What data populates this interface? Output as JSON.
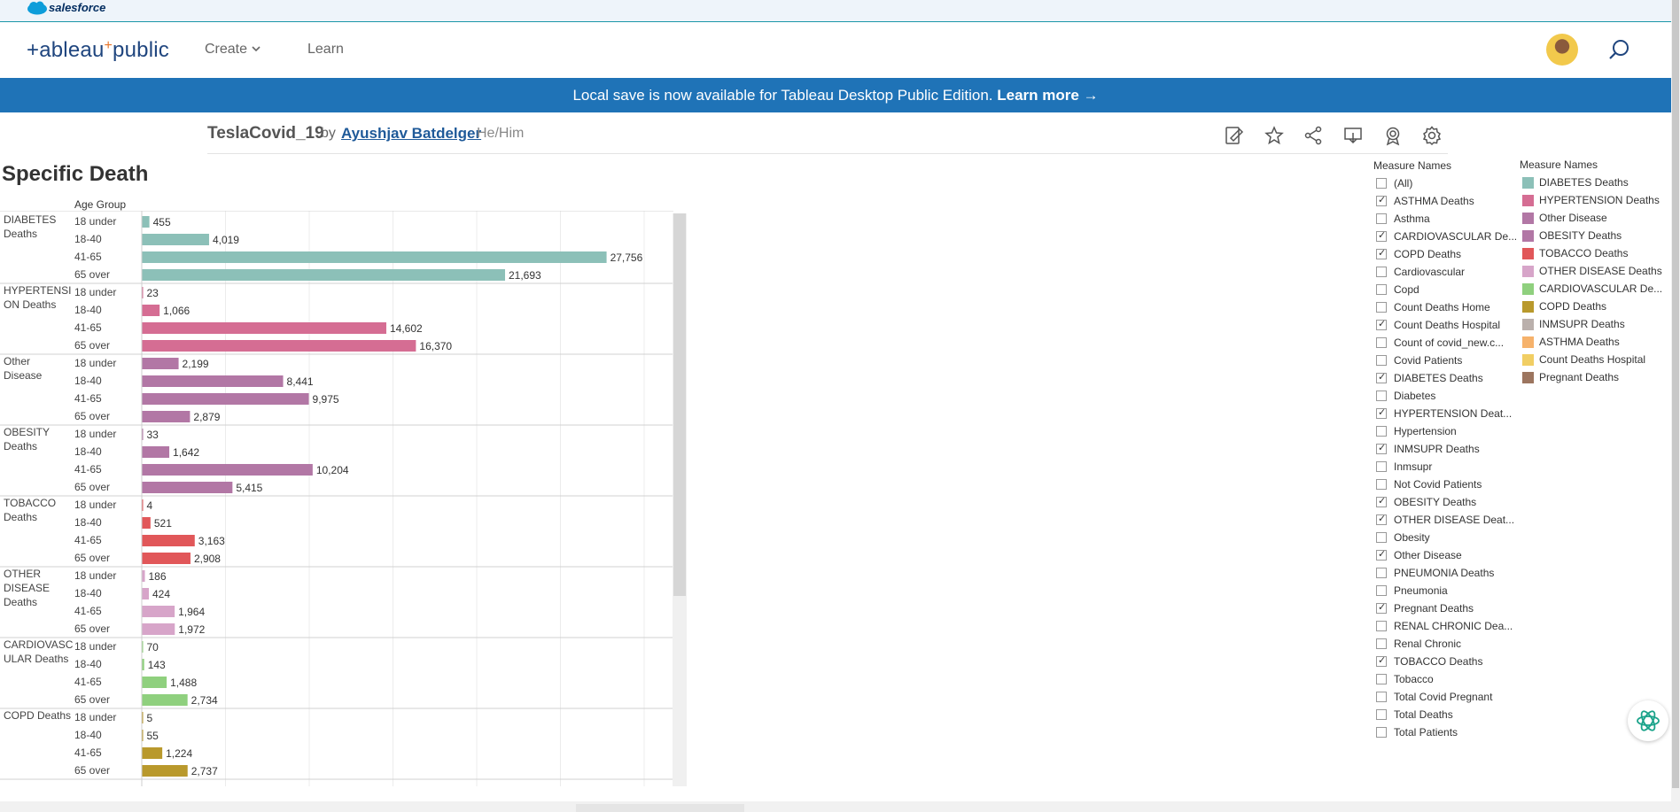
{
  "topbar": {
    "brand": "salesforce"
  },
  "header": {
    "logo_text": "+ableau",
    "logo_plus": "+",
    "logo_suffix": "public",
    "nav": [
      {
        "label": "Create"
      },
      {
        "label": "Learn"
      }
    ],
    "icons": [
      "chevron-down-icon",
      "avatar",
      "search-icon"
    ]
  },
  "banner": {
    "text": "Local save is now available for Tableau Desktop Public Edition.",
    "link": "Learn more →"
  },
  "viz": {
    "title": "TeslaCovid_19",
    "by": "by",
    "author": "Ayushjav Batdelger",
    "pronoun": "He/Him",
    "toolbar_icons": [
      "edit-icon",
      "star-icon",
      "share-icon",
      "download-icon",
      "badge-icon",
      "settings-icon"
    ]
  },
  "sheet": {
    "title": "Specific Death",
    "age_header": "Age Group"
  },
  "colors": {
    "DIABETES Deaths": "#8cc0b8",
    "HYPERTENSION Deaths": "#d56d93",
    "Other Disease": "#b277a5",
    "OBESITY Deaths": "#b277a5",
    "TOBACCO Deaths": "#e15759",
    "OTHER DISEASE Deaths": "#d7a5c9",
    "CARDIOVASCULAR Deaths": "#8fd07e",
    "COPD Deaths": "#b9992c",
    "axis_band": "#8ec1d2"
  },
  "chart_data": {
    "type": "bar",
    "orientation": "horizontal",
    "title": "Specific Death",
    "ylabel": "Age Group",
    "xlim": [
      0,
      30000
    ],
    "x_ticks": [
      "0K",
      "5K",
      "10K",
      "15K",
      "20K",
      "25K",
      "30K"
    ],
    "grid": true,
    "categories": [
      "18 under",
      "18-40",
      "41-65",
      "65 over"
    ],
    "series": [
      {
        "name": "DIABETES Deaths",
        "label": "DIABETES\nDeaths",
        "values": [
          455,
          4019,
          27756,
          21693
        ],
        "labels": [
          "455",
          "4,019",
          "27,756",
          "21,693"
        ]
      },
      {
        "name": "HYPERTENSION Deaths",
        "label": "HYPERTENSI\nON Deaths",
        "values": [
          23,
          1066,
          14602,
          16370
        ],
        "labels": [
          "23",
          "1,066",
          "14,602",
          "16,370"
        ]
      },
      {
        "name": "Other Disease",
        "label": "Other\nDisease",
        "values": [
          2199,
          8441,
          9975,
          2879
        ],
        "labels": [
          "2,199",
          "8,441",
          "9,975",
          "2,879"
        ]
      },
      {
        "name": "OBESITY Deaths",
        "label": "OBESITY\nDeaths",
        "values": [
          33,
          1642,
          10204,
          5415
        ],
        "labels": [
          "33",
          "1,642",
          "10,204",
          "5,415"
        ]
      },
      {
        "name": "TOBACCO Deaths",
        "label": "TOBACCO\nDeaths",
        "values": [
          4,
          521,
          3163,
          2908
        ],
        "labels": [
          "4",
          "521",
          "3,163",
          "2,908"
        ]
      },
      {
        "name": "OTHER DISEASE Deaths",
        "label": "OTHER\nDISEASE\nDeaths",
        "values": [
          186,
          424,
          1964,
          1972
        ],
        "labels": [
          "186",
          "424",
          "1,964",
          "1,972"
        ]
      },
      {
        "name": "CARDIOVASCULAR Deaths",
        "label": "CARDIOVASC\nULAR Deaths",
        "values": [
          70,
          143,
          1488,
          2734
        ],
        "labels": [
          "70",
          "143",
          "1,488",
          "2,734"
        ]
      },
      {
        "name": "COPD Deaths",
        "label": "COPD Deaths",
        "values": [
          5,
          55,
          1224,
          2737
        ],
        "labels": [
          "5",
          "55",
          "1,224",
          "2,737"
        ]
      }
    ]
  },
  "filter": {
    "title": "Measure Names",
    "items": [
      {
        "label": "(All)",
        "checked": false
      },
      {
        "label": "ASTHMA Deaths",
        "checked": true
      },
      {
        "label": "Asthma",
        "checked": false
      },
      {
        "label": "CARDIOVASCULAR De...",
        "checked": true
      },
      {
        "label": "COPD Deaths",
        "checked": true
      },
      {
        "label": "Cardiovascular",
        "checked": false
      },
      {
        "label": "Copd",
        "checked": false
      },
      {
        "label": "Count Deaths Home",
        "checked": false
      },
      {
        "label": "Count Deaths Hospital",
        "checked": true
      },
      {
        "label": "Count of covid_new.c...",
        "checked": false
      },
      {
        "label": "Covid Patients",
        "checked": false
      },
      {
        "label": "DIABETES Deaths",
        "checked": true
      },
      {
        "label": "Diabetes",
        "checked": false
      },
      {
        "label": "HYPERTENSION Deat...",
        "checked": true
      },
      {
        "label": "Hypertension",
        "checked": false
      },
      {
        "label": "INMSUPR Deaths",
        "checked": true
      },
      {
        "label": "Inmsupr",
        "checked": false
      },
      {
        "label": "Not Covid Patients",
        "checked": false
      },
      {
        "label": "OBESITY Deaths",
        "checked": true
      },
      {
        "label": "OTHER DISEASE Deat...",
        "checked": true
      },
      {
        "label": "Obesity",
        "checked": false
      },
      {
        "label": "Other Disease",
        "checked": true
      },
      {
        "label": "PNEUMONIA Deaths",
        "checked": false
      },
      {
        "label": "Pneumonia",
        "checked": false
      },
      {
        "label": "Pregnant Deaths",
        "checked": true
      },
      {
        "label": "RENAL CHRONIC Dea...",
        "checked": false
      },
      {
        "label": "Renal Chronic",
        "checked": false
      },
      {
        "label": "TOBACCO Deaths",
        "checked": true
      },
      {
        "label": "Tobacco",
        "checked": false
      },
      {
        "label": "Total Covid Pregnant",
        "checked": false
      },
      {
        "label": "Total Deaths",
        "checked": false
      },
      {
        "label": "Total Patients",
        "checked": false
      }
    ]
  },
  "legend": {
    "title": "Measure Names",
    "items": [
      {
        "label": "DIABETES Deaths",
        "color": "#8cc0b8"
      },
      {
        "label": "HYPERTENSION Deaths",
        "color": "#d56d93"
      },
      {
        "label": "Other Disease",
        "color": "#b277a5"
      },
      {
        "label": "OBESITY Deaths",
        "color": "#b277a5"
      },
      {
        "label": "TOBACCO Deaths",
        "color": "#e15759"
      },
      {
        "label": "OTHER DISEASE Deaths",
        "color": "#d7a5c9"
      },
      {
        "label": "CARDIOVASCULAR De...",
        "color": "#8fd07e"
      },
      {
        "label": "COPD Deaths",
        "color": "#b9992c"
      },
      {
        "label": "INMSUPR Deaths",
        "color": "#bab0ac"
      },
      {
        "label": "ASTHMA Deaths",
        "color": "#f6b26b"
      },
      {
        "label": "Count Deaths Hospital",
        "color": "#f1ce63"
      },
      {
        "label": "Pregnant Deaths",
        "color": "#9c755f"
      }
    ]
  }
}
